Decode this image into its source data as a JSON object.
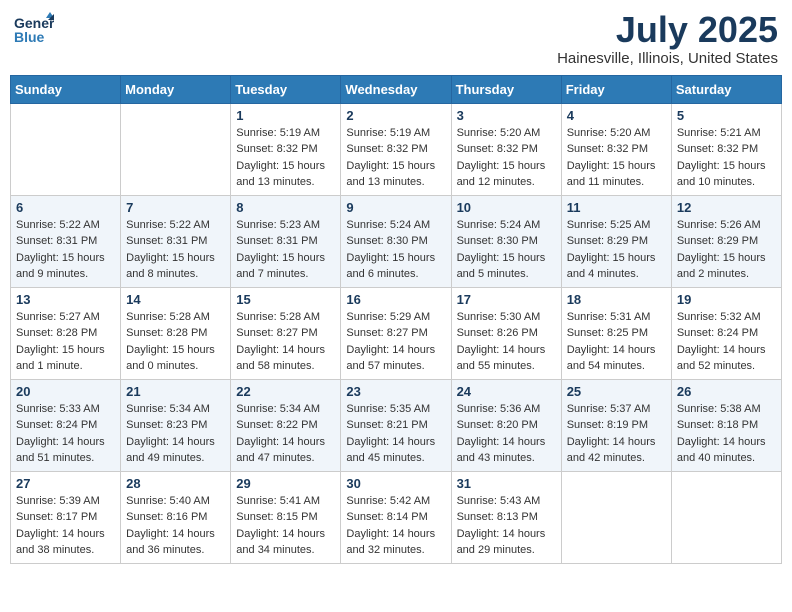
{
  "header": {
    "logo_general": "General",
    "logo_blue": "Blue",
    "month_title": "July 2025",
    "location": "Hainesville, Illinois, United States"
  },
  "weekdays": [
    "Sunday",
    "Monday",
    "Tuesday",
    "Wednesday",
    "Thursday",
    "Friday",
    "Saturday"
  ],
  "weeks": [
    [
      {
        "day": "",
        "info": ""
      },
      {
        "day": "",
        "info": ""
      },
      {
        "day": "1",
        "info": "Sunrise: 5:19 AM\nSunset: 8:32 PM\nDaylight: 15 hours\nand 13 minutes."
      },
      {
        "day": "2",
        "info": "Sunrise: 5:19 AM\nSunset: 8:32 PM\nDaylight: 15 hours\nand 13 minutes."
      },
      {
        "day": "3",
        "info": "Sunrise: 5:20 AM\nSunset: 8:32 PM\nDaylight: 15 hours\nand 12 minutes."
      },
      {
        "day": "4",
        "info": "Sunrise: 5:20 AM\nSunset: 8:32 PM\nDaylight: 15 hours\nand 11 minutes."
      },
      {
        "day": "5",
        "info": "Sunrise: 5:21 AM\nSunset: 8:32 PM\nDaylight: 15 hours\nand 10 minutes."
      }
    ],
    [
      {
        "day": "6",
        "info": "Sunrise: 5:22 AM\nSunset: 8:31 PM\nDaylight: 15 hours\nand 9 minutes."
      },
      {
        "day": "7",
        "info": "Sunrise: 5:22 AM\nSunset: 8:31 PM\nDaylight: 15 hours\nand 8 minutes."
      },
      {
        "day": "8",
        "info": "Sunrise: 5:23 AM\nSunset: 8:31 PM\nDaylight: 15 hours\nand 7 minutes."
      },
      {
        "day": "9",
        "info": "Sunrise: 5:24 AM\nSunset: 8:30 PM\nDaylight: 15 hours\nand 6 minutes."
      },
      {
        "day": "10",
        "info": "Sunrise: 5:24 AM\nSunset: 8:30 PM\nDaylight: 15 hours\nand 5 minutes."
      },
      {
        "day": "11",
        "info": "Sunrise: 5:25 AM\nSunset: 8:29 PM\nDaylight: 15 hours\nand 4 minutes."
      },
      {
        "day": "12",
        "info": "Sunrise: 5:26 AM\nSunset: 8:29 PM\nDaylight: 15 hours\nand 2 minutes."
      }
    ],
    [
      {
        "day": "13",
        "info": "Sunrise: 5:27 AM\nSunset: 8:28 PM\nDaylight: 15 hours\nand 1 minute."
      },
      {
        "day": "14",
        "info": "Sunrise: 5:28 AM\nSunset: 8:28 PM\nDaylight: 15 hours\nand 0 minutes."
      },
      {
        "day": "15",
        "info": "Sunrise: 5:28 AM\nSunset: 8:27 PM\nDaylight: 14 hours\nand 58 minutes."
      },
      {
        "day": "16",
        "info": "Sunrise: 5:29 AM\nSunset: 8:27 PM\nDaylight: 14 hours\nand 57 minutes."
      },
      {
        "day": "17",
        "info": "Sunrise: 5:30 AM\nSunset: 8:26 PM\nDaylight: 14 hours\nand 55 minutes."
      },
      {
        "day": "18",
        "info": "Sunrise: 5:31 AM\nSunset: 8:25 PM\nDaylight: 14 hours\nand 54 minutes."
      },
      {
        "day": "19",
        "info": "Sunrise: 5:32 AM\nSunset: 8:24 PM\nDaylight: 14 hours\nand 52 minutes."
      }
    ],
    [
      {
        "day": "20",
        "info": "Sunrise: 5:33 AM\nSunset: 8:24 PM\nDaylight: 14 hours\nand 51 minutes."
      },
      {
        "day": "21",
        "info": "Sunrise: 5:34 AM\nSunset: 8:23 PM\nDaylight: 14 hours\nand 49 minutes."
      },
      {
        "day": "22",
        "info": "Sunrise: 5:34 AM\nSunset: 8:22 PM\nDaylight: 14 hours\nand 47 minutes."
      },
      {
        "day": "23",
        "info": "Sunrise: 5:35 AM\nSunset: 8:21 PM\nDaylight: 14 hours\nand 45 minutes."
      },
      {
        "day": "24",
        "info": "Sunrise: 5:36 AM\nSunset: 8:20 PM\nDaylight: 14 hours\nand 43 minutes."
      },
      {
        "day": "25",
        "info": "Sunrise: 5:37 AM\nSunset: 8:19 PM\nDaylight: 14 hours\nand 42 minutes."
      },
      {
        "day": "26",
        "info": "Sunrise: 5:38 AM\nSunset: 8:18 PM\nDaylight: 14 hours\nand 40 minutes."
      }
    ],
    [
      {
        "day": "27",
        "info": "Sunrise: 5:39 AM\nSunset: 8:17 PM\nDaylight: 14 hours\nand 38 minutes."
      },
      {
        "day": "28",
        "info": "Sunrise: 5:40 AM\nSunset: 8:16 PM\nDaylight: 14 hours\nand 36 minutes."
      },
      {
        "day": "29",
        "info": "Sunrise: 5:41 AM\nSunset: 8:15 PM\nDaylight: 14 hours\nand 34 minutes."
      },
      {
        "day": "30",
        "info": "Sunrise: 5:42 AM\nSunset: 8:14 PM\nDaylight: 14 hours\nand 32 minutes."
      },
      {
        "day": "31",
        "info": "Sunrise: 5:43 AM\nSunset: 8:13 PM\nDaylight: 14 hours\nand 29 minutes."
      },
      {
        "day": "",
        "info": ""
      },
      {
        "day": "",
        "info": ""
      }
    ]
  ]
}
